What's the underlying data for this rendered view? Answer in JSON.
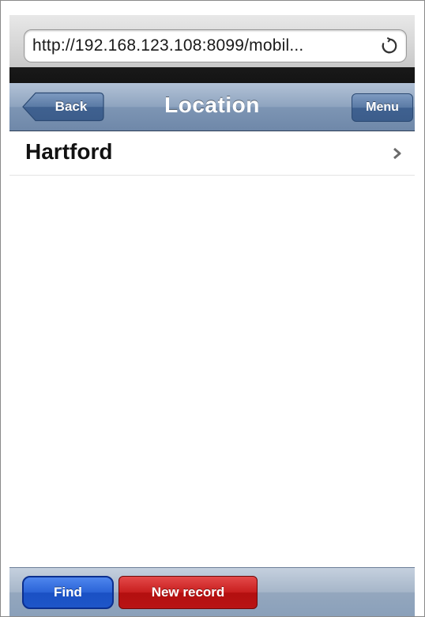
{
  "browser": {
    "url": "http://192.168.123.108:8099/mobil..."
  },
  "navbar": {
    "title": "Location",
    "back_label": "Back",
    "menu_label": "Menu"
  },
  "list": {
    "items": [
      {
        "label": "Hartford",
        "icon": "chevron-right-icon"
      }
    ]
  },
  "toolbar": {
    "find_label": "Find",
    "new_record_label": "New record"
  },
  "colors": {
    "nav_bar": "#8ea4bf",
    "find_button": "#2a63d6",
    "new_record_button": "#c81e1e"
  }
}
